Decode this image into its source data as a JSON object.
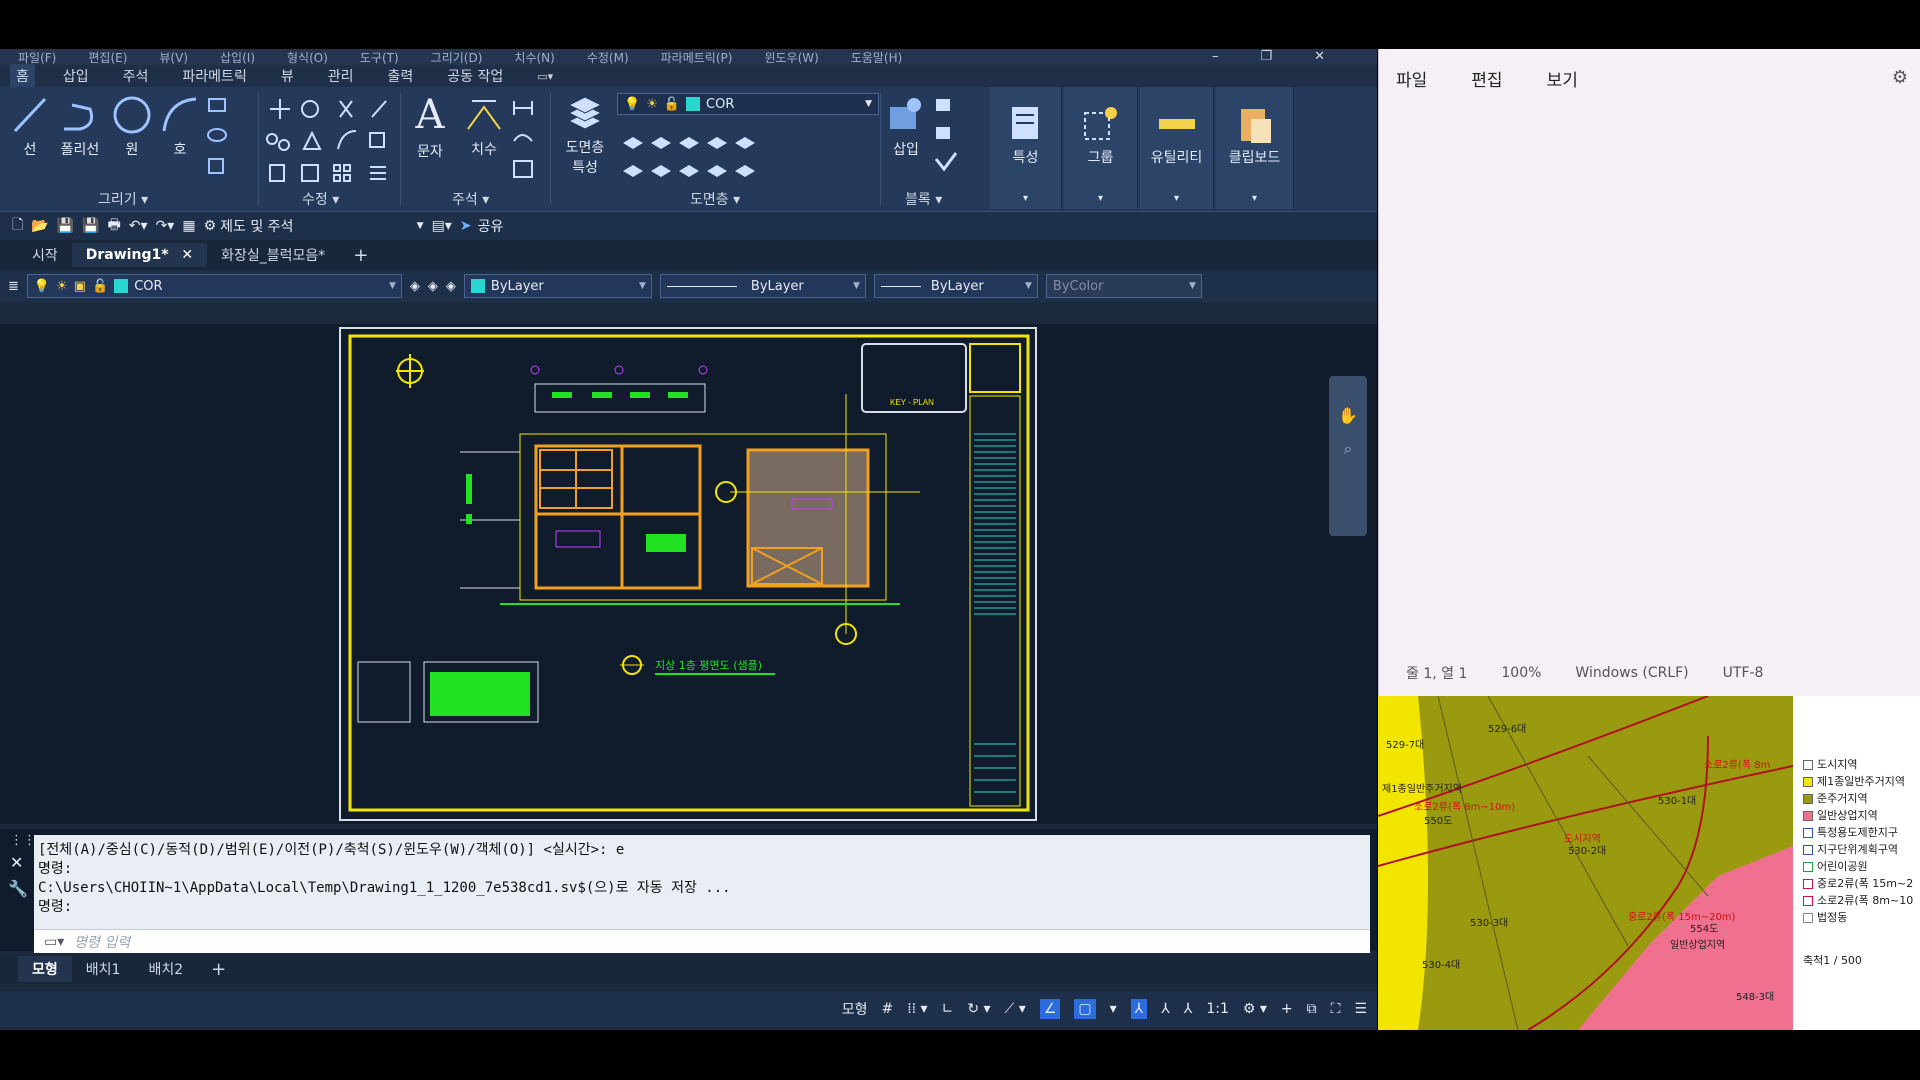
{
  "cad": {
    "menu": [
      "파일(F)",
      "편집(E)",
      "뷰(V)",
      "삽입(I)",
      "형식(O)",
      "도구(T)",
      "그리기(D)",
      "치수(N)",
      "수정(M)",
      "파라메트릭(P)",
      "윈도우(W)",
      "도움말(H)"
    ],
    "ribbon_tabs": [
      "홈",
      "삽입",
      "주석",
      "파라메트릭",
      "뷰",
      "관리",
      "출력",
      "공동 작업"
    ],
    "tools": {
      "line": "선",
      "polyline": "폴리선",
      "circle": "원",
      "arc": "호",
      "text": "문자",
      "dimension": "치수",
      "layer_props_1": "도면층",
      "layer_props_2": "특성",
      "insert": "삽입",
      "properties": "특성",
      "group": "그룹",
      "utilities": "유틸리티",
      "clipboard": "클립보드"
    },
    "groups": {
      "draw": "그리기",
      "modify": "수정",
      "annotation": "주석",
      "layers": "도면층",
      "block": "블록"
    },
    "layer_current": "COR",
    "workspace": "제도 및 주석",
    "share": "공유",
    "doc_tabs": [
      "시작",
      "Drawing1*",
      "화장실_블럭모음*"
    ],
    "props": {
      "layer": "COR",
      "color": "ByLayer",
      "linetype": "ByLayer",
      "lineweight": "ByLayer",
      "plotstyle": "ByColor"
    },
    "drawing": {
      "key_plan": "KEY - PLAN",
      "plan_title": "지상 1층 평면도 (샘플)"
    },
    "command_history": [
      "[전체(A)/중심(C)/동적(D)/범위(E)/이전(P)/축척(S)/윈도우(W)/객체(O)] <실시간>: e",
      "명령:",
      "C:\\Users\\CHOIIN~1\\AppData\\Local\\Temp\\Drawing1_1_1200_7e538cd1.sv$(으)로 자동 저장 ...",
      "명령:"
    ],
    "command_placeholder": "명령 입력",
    "layout_tabs": [
      "모형",
      "배치1",
      "배치2"
    ],
    "status": {
      "model": "모형",
      "scale": "1:1"
    }
  },
  "notepad": {
    "menu": [
      "파일",
      "편집",
      "보기"
    ],
    "status": {
      "position": "줄 1, 열 1",
      "zoom": "100%",
      "eol": "Windows (CRLF)",
      "encoding": "UTF-8"
    }
  },
  "map": {
    "labels": [
      "529-6대",
      "529-7대",
      "제1종일반주거지역",
      "소로2류(폭 8m~10m)",
      "550도",
      "530-1대",
      "도시지역",
      "530-2대",
      "530-3대",
      "중로2류(폭 15m~20m)",
      "554도",
      "일반상업지역",
      "530-4대",
      "548-3대",
      "소로2류(폭 8m"
    ],
    "legend": [
      "도시지역",
      "제1종일반주거지역",
      "준주거지역",
      "일반상업지역",
      "특정용도제한지구",
      "지구단위계획구역",
      "어린이공원",
      "중로2류(폭 15m~2",
      "소로2류(폭 8m~10",
      "법정동"
    ],
    "legend_colors": [
      "#ffffff",
      "#f2e600",
      "#9a9a10",
      "#f07090",
      "#ffffff",
      "#ffffff",
      "#ffffff",
      "#ffffff",
      "#ffffff",
      "#ffffff"
    ],
    "scale": "축척1 / 500"
  }
}
